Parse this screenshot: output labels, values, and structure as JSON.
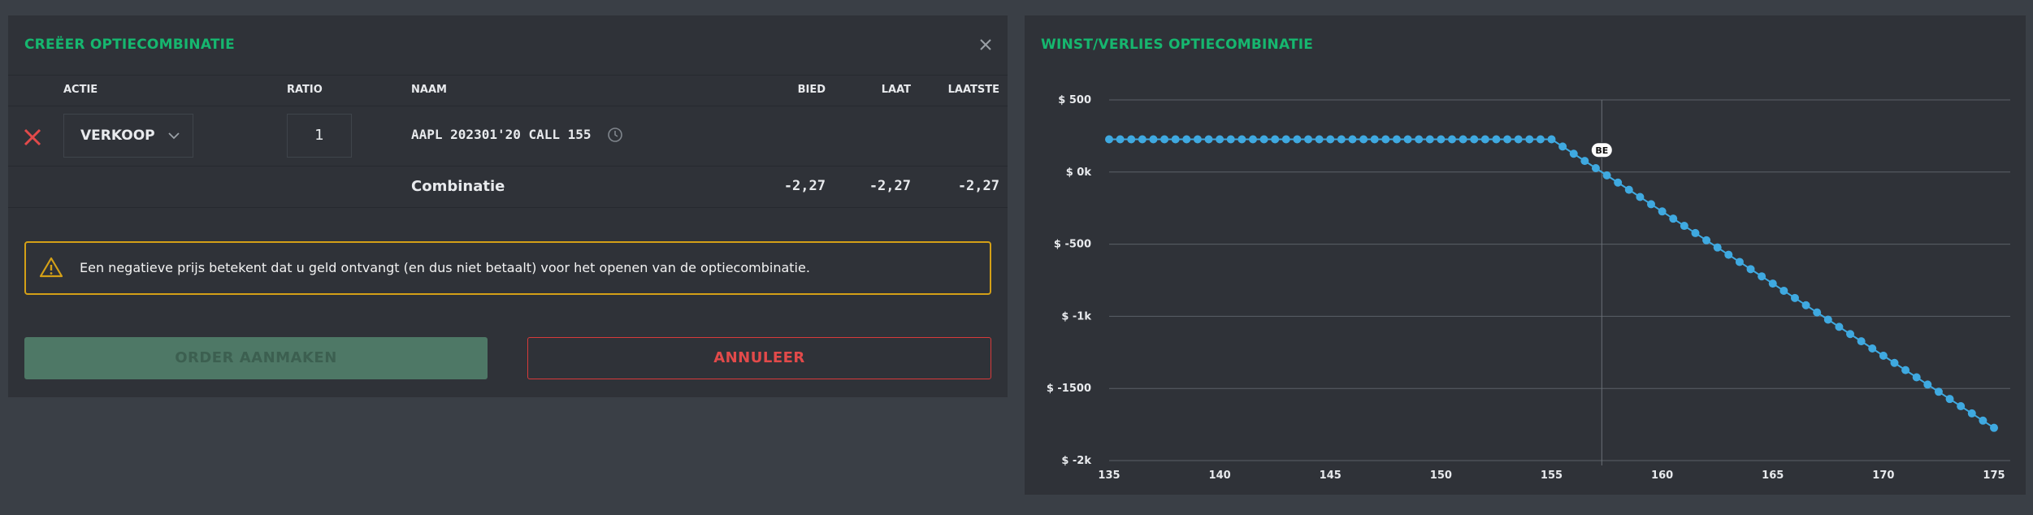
{
  "left_panel": {
    "title": "CREËER OPTIECOMBINATIE",
    "close_icon": "close-icon",
    "columns": {
      "actie": "ACTIE",
      "ratio": "RATIO",
      "naam": "NAAM",
      "bied": "BIED",
      "laat": "LAAT",
      "laatste": "LAATSTE"
    },
    "leg": {
      "delete_icon": "delete-x-icon",
      "action": "VERKOOP",
      "ratio": "1",
      "name": "AAPL 202301'20 CALL 155",
      "clock_icon": "clock-icon"
    },
    "combination": {
      "label": "Combinatie",
      "bied": "-2,27",
      "laat": "-2,27",
      "laatste": "-2,27"
    },
    "warning": {
      "icon": "warning-triangle-icon",
      "text": "Een negatieve prijs betekent dat u geld ontvangt (en dus niet betaalt) voor het openen van de optiecombinatie."
    },
    "buttons": {
      "order": "ORDER AANMAKEN",
      "cancel": "ANNULEER"
    },
    "colors": {
      "accent": "#16b76f",
      "warning": "#d4a017",
      "danger": "#e24a4a",
      "order_disabled": "#4e7866"
    }
  },
  "right_panel": {
    "title": "WINST/VERLIES OPTIECOMBINATIE"
  },
  "chart_data": {
    "type": "line",
    "x_ticks": [
      "135",
      "140",
      "145",
      "150",
      "155",
      "160",
      "165",
      "170",
      "175"
    ],
    "y_ticks": [
      "$ 500",
      "$ 0k",
      "$ -500",
      "$ -1k",
      "$ -1500",
      "$ -2k"
    ],
    "xlim": [
      135,
      175
    ],
    "ylim": [
      -2000,
      500
    ],
    "strike": 155,
    "premium": 227,
    "break_even": 157.27,
    "break_even_label": "BE",
    "series": [
      {
        "color": "#3fa9e0",
        "x_start": 135,
        "x_end": 175,
        "x_step": 0.5
      }
    ],
    "grid": true
  }
}
